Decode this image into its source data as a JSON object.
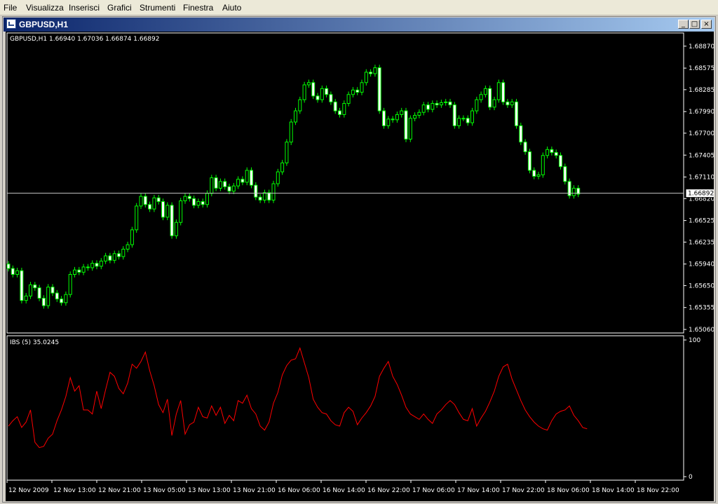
{
  "menu": {
    "items": [
      "File",
      "Visualizza",
      "Inserisci",
      "Grafici",
      "Strumenti",
      "Finestra",
      "Aiuto"
    ]
  },
  "window": {
    "title": "GBPUSD,H1"
  },
  "chart_data": [
    {
      "type": "candlestick",
      "title": "GBPUSD,H1  1.66940 1.67036 1.66874 1.66892",
      "symbol": "GBPUSD,H1",
      "ohlc_readout": [
        "1.66940",
        "1.67036",
        "1.66874",
        "1.66892"
      ],
      "ylim": [
        1.6506,
        1.6901
      ],
      "y_ticks": [
        "1.68870",
        "1.68575",
        "1.68285",
        "1.67990",
        "1.67700",
        "1.67405",
        "1.67110",
        "1.66820",
        "1.66525",
        "1.66235",
        "1.65940",
        "1.65650",
        "1.65355",
        "1.65060"
      ],
      "current_price": "1.66892",
      "candle_color": "#ffffff",
      "wick_color": "#00ff00",
      "x_labels": [
        "12 Nov 2009",
        "12 Nov 13:00",
        "12 Nov 21:00",
        "13 Nov 05:00",
        "13 Nov 13:00",
        "13 Nov 21:00",
        "16 Nov 06:00",
        "16 Nov 14:00",
        "16 Nov 22:00",
        "17 Nov 06:00",
        "17 Nov 14:00",
        "17 Nov 22:00",
        "18 Nov 06:00",
        "18 Nov 14:00",
        "18 Nov 22:00"
      ],
      "closes": [
        1.6588,
        1.658,
        1.6585,
        1.6545,
        1.6551,
        1.6566,
        1.6562,
        1.6548,
        1.6538,
        1.6563,
        1.6555,
        1.6547,
        1.6542,
        1.6553,
        1.658,
        1.6586,
        1.6583,
        1.659,
        1.6589,
        1.6595,
        1.6591,
        1.6598,
        1.6605,
        1.6599,
        1.6608,
        1.6604,
        1.6614,
        1.662,
        1.664,
        1.6672,
        1.6685,
        1.6674,
        1.6668,
        1.6683,
        1.6678,
        1.6657,
        1.6673,
        1.6632,
        1.665,
        1.6679,
        1.6685,
        1.6682,
        1.6673,
        1.6678,
        1.6674,
        1.6689,
        1.671,
        1.6696,
        1.6705,
        1.6698,
        1.6692,
        1.6699,
        1.6708,
        1.6704,
        1.672,
        1.67,
        1.6684,
        1.668,
        1.669,
        1.668,
        1.6702,
        1.6718,
        1.673,
        1.6758,
        1.6785,
        1.68,
        1.6815,
        1.6835,
        1.6838,
        1.682,
        1.6815,
        1.683,
        1.6822,
        1.6812,
        1.68,
        1.6795,
        1.681,
        1.6822,
        1.6828,
        1.6825,
        1.6838,
        1.6852,
        1.685,
        1.6858,
        1.68,
        1.678,
        1.6789,
        1.6788,
        1.6795,
        1.68,
        1.6762,
        1.679,
        1.6794,
        1.6798,
        1.6808,
        1.6802,
        1.681,
        1.6808,
        1.6811,
        1.6812,
        1.6808,
        1.678,
        1.679,
        1.679,
        1.6784,
        1.68,
        1.6815,
        1.6822,
        1.683,
        1.6805,
        1.6815,
        1.6838,
        1.6812,
        1.6808,
        1.6812,
        1.678,
        1.6758,
        1.6745,
        1.672,
        1.6712,
        1.6714,
        1.674,
        1.6748,
        1.6744,
        1.674,
        1.6725,
        1.6705,
        1.6686,
        1.6696,
        1.6688
      ],
      "ibs_values": [
        36,
        40,
        43,
        35,
        39,
        48,
        24,
        20,
        21,
        27,
        30,
        40,
        48,
        58,
        72,
        62,
        66,
        48,
        48,
        45,
        62,
        49,
        63,
        76,
        73,
        64,
        60,
        68,
        82,
        79,
        84,
        91,
        77,
        66,
        52,
        46,
        56,
        29,
        45,
        55,
        30,
        37,
        39,
        50,
        43,
        42,
        51,
        44,
        50,
        38,
        44,
        40,
        55,
        53,
        59,
        49,
        45,
        36,
        33,
        39,
        53,
        61,
        74,
        81,
        85,
        86,
        94,
        83,
        72,
        56,
        50,
        46,
        45,
        40,
        37,
        36,
        46,
        50,
        47,
        37,
        42,
        46,
        51,
        58,
        73,
        79,
        84,
        73,
        67,
        59,
        50,
        45,
        43,
        41,
        45,
        41,
        38,
        45,
        48,
        52,
        55,
        52,
        46,
        41,
        40,
        49,
        36,
        42,
        47,
        54,
        62,
        73,
        80,
        82,
        71,
        63,
        55,
        48,
        43,
        39,
        36,
        34,
        33,
        40,
        45,
        47,
        48,
        51,
        44,
        40,
        35,
        34
      ]
    },
    {
      "type": "line",
      "title": "IBS (5)  35.0245",
      "indicator_label": "IBS (5)",
      "indicator_value": "35.0245",
      "ylim": [
        0,
        100
      ],
      "y_ticks": [
        "100",
        "0"
      ],
      "line_color": "#ff0000"
    }
  ]
}
